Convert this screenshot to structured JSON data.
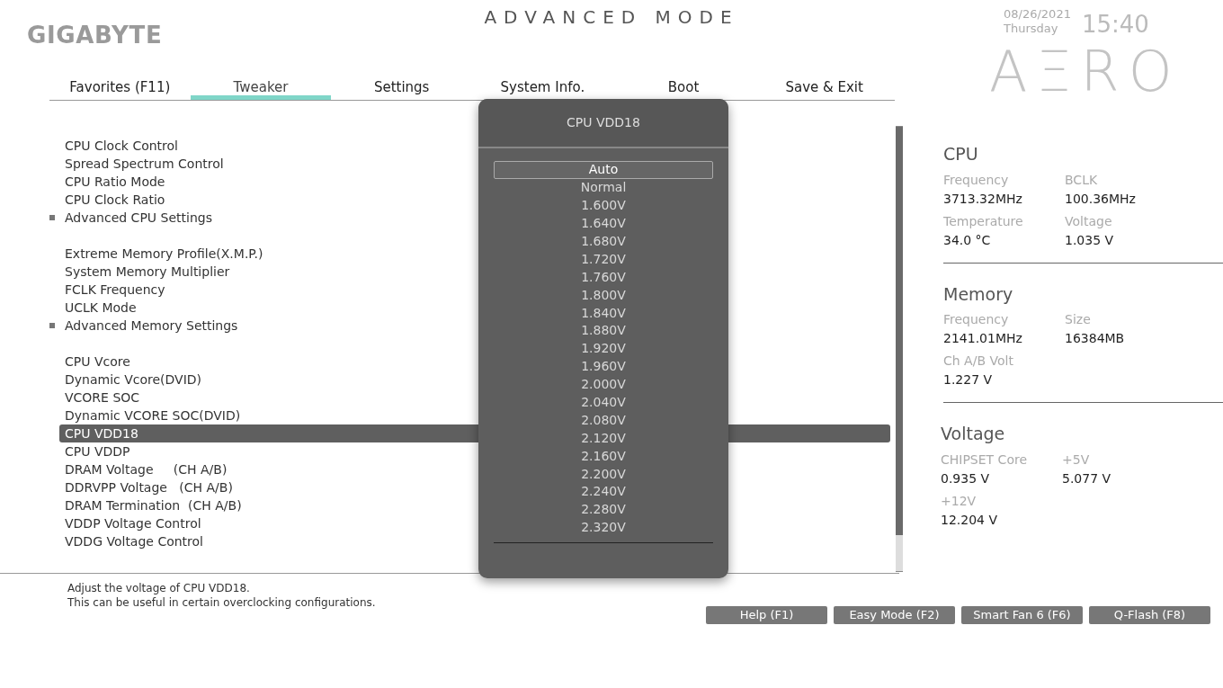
{
  "header": {
    "logo": "GIGABYTE",
    "mode_title": "ADVANCED MODE",
    "date": "08/26/2021",
    "day": "Thursday",
    "time": "15:40",
    "brand": "AΞRO"
  },
  "tabs": [
    {
      "label": "Favorites (F11)",
      "selected": false
    },
    {
      "label": "Tweaker",
      "selected": true
    },
    {
      "label": "Settings",
      "selected": false
    },
    {
      "label": "System Info.",
      "selected": false
    },
    {
      "label": "Boot",
      "selected": false
    },
    {
      "label": "Save & Exit",
      "selected": false
    }
  ],
  "setting_groups": [
    [
      {
        "label": "CPU Clock Control",
        "kind": "item",
        "selected": false
      },
      {
        "label": "Spread Spectrum Control",
        "kind": "item",
        "selected": false
      },
      {
        "label": "CPU Ratio Mode",
        "kind": "item",
        "selected": false
      },
      {
        "label": "CPU Clock Ratio",
        "kind": "item",
        "selected": false
      },
      {
        "label": "Advanced CPU Settings",
        "kind": "submenu",
        "selected": false
      }
    ],
    [
      {
        "label": "Extreme Memory Profile(X.M.P.)",
        "kind": "item",
        "selected": false
      },
      {
        "label": "System Memory Multiplier",
        "kind": "item",
        "selected": false
      },
      {
        "label": "FCLK Frequency",
        "kind": "item",
        "selected": false
      },
      {
        "label": "UCLK Mode",
        "kind": "item",
        "selected": false
      },
      {
        "label": "Advanced Memory Settings",
        "kind": "submenu",
        "selected": false
      }
    ],
    [
      {
        "label": "CPU Vcore",
        "kind": "item",
        "selected": false
      },
      {
        "label": "Dynamic Vcore(DVID)",
        "kind": "item",
        "selected": false
      },
      {
        "label": "VCORE SOC",
        "kind": "item",
        "selected": false
      },
      {
        "label": "Dynamic VCORE SOC(DVID)",
        "kind": "item",
        "selected": false
      },
      {
        "label": "CPU VDD18",
        "kind": "item",
        "selected": true
      },
      {
        "label": "CPU VDDP",
        "kind": "item",
        "selected": false
      },
      {
        "label": "DRAM Voltage     (CH A/B)",
        "kind": "item",
        "selected": false
      },
      {
        "label": "DDRVPP Voltage   (CH A/B)",
        "kind": "item",
        "selected": false
      },
      {
        "label": "DRAM Termination  (CH A/B)",
        "kind": "item",
        "selected": false
      },
      {
        "label": "VDDP Voltage Control",
        "kind": "item",
        "selected": false
      },
      {
        "label": "VDDG Voltage Control",
        "kind": "item",
        "selected": false
      }
    ]
  ],
  "popup": {
    "title": "CPU VDD18",
    "options": [
      {
        "label": "Auto",
        "selected": true
      },
      {
        "label": "Normal",
        "selected": false
      },
      {
        "label": "1.600V",
        "selected": false
      },
      {
        "label": "1.640V",
        "selected": false
      },
      {
        "label": "1.680V",
        "selected": false
      },
      {
        "label": "1.720V",
        "selected": false
      },
      {
        "label": "1.760V",
        "selected": false
      },
      {
        "label": "1.800V",
        "selected": false
      },
      {
        "label": "1.840V",
        "selected": false
      },
      {
        "label": "1.880V",
        "selected": false
      },
      {
        "label": "1.920V",
        "selected": false
      },
      {
        "label": "1.960V",
        "selected": false
      },
      {
        "label": "2.000V",
        "selected": false
      },
      {
        "label": "2.040V",
        "selected": false
      },
      {
        "label": "2.080V",
        "selected": false
      },
      {
        "label": "2.120V",
        "selected": false
      },
      {
        "label": "2.160V",
        "selected": false
      },
      {
        "label": "2.200V",
        "selected": false
      },
      {
        "label": "2.240V",
        "selected": false
      },
      {
        "label": "2.280V",
        "selected": false
      },
      {
        "label": "2.320V",
        "selected": false
      }
    ]
  },
  "info": [
    {
      "title": "CPU",
      "fields": [
        {
          "label": "Frequency",
          "value": "3713.32MHz"
        },
        {
          "label": "BCLK",
          "value": "100.36MHz"
        },
        {
          "label": "Temperature",
          "value": "34.0 °C"
        },
        {
          "label": "Voltage",
          "value": "1.035 V"
        }
      ]
    },
    {
      "title": "Memory",
      "fields": [
        {
          "label": "Frequency",
          "value": "2141.01MHz"
        },
        {
          "label": "Size",
          "value": "16384MB"
        },
        {
          "label": "Ch A/B Volt",
          "value": "1.227 V"
        }
      ]
    },
    {
      "title": "Voltage",
      "fields": [
        {
          "label": "CHIPSET Core",
          "value": "0.935 V"
        },
        {
          "label": "+5V",
          "value": "5.077 V"
        },
        {
          "label": "+12V",
          "value": "12.204 V"
        }
      ]
    }
  ],
  "help_text": [
    "Adjust the voltage of CPU VDD18.",
    "This can be useful in certain overclocking configurations."
  ],
  "buttons": [
    "Help (F1)",
    "Easy Mode (F2)",
    "Smart Fan 6 (F6)",
    "Q-Flash (F8)"
  ]
}
